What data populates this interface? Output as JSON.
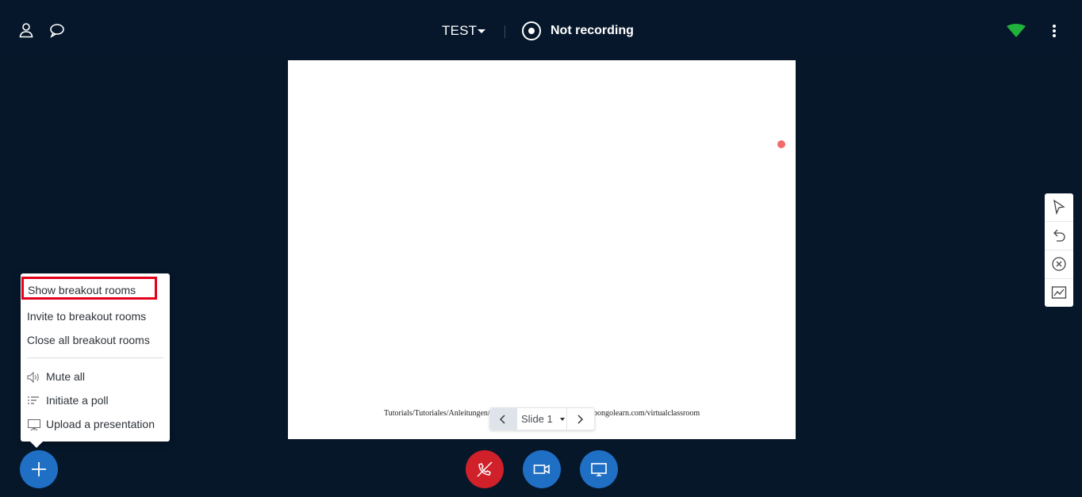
{
  "header": {
    "meeting_title": "TEST",
    "recording_status": "Not recording"
  },
  "presentation": {
    "footer_left": "Tutorials/Tutoriales/Anleitungen/",
    "footer_right": "bongolearn.com/virtualclassroom",
    "slide_selector": "Slide 1"
  },
  "actions_menu": {
    "items": [
      {
        "label": "Show breakout rooms"
      },
      {
        "label": "Invite to breakout rooms"
      },
      {
        "label": "Close all breakout rooms"
      },
      {
        "label": "Mute all",
        "icon": "speaker-icon"
      },
      {
        "label": "Initiate a poll",
        "icon": "poll-icon"
      },
      {
        "label": "Upload a presentation",
        "icon": "presentation-icon"
      }
    ]
  },
  "colors": {
    "background": "#06172a",
    "primary_blue": "#1f6fc5",
    "hangup_red": "#d0202a",
    "signal_green": "#1fb13a",
    "highlight_red": "#e3001b"
  },
  "icons": {
    "top_left": [
      "user-icon",
      "chat-icon"
    ],
    "top_right": [
      "connection-signal-icon",
      "more-options-icon"
    ],
    "toolbar": [
      "pointer-tool-icon",
      "undo-icon",
      "clear-annotations-icon",
      "multi-user-whiteboard-icon"
    ],
    "bottom": [
      "plus-icon",
      "hang-up-icon",
      "video-camera-icon",
      "screen-share-icon"
    ]
  }
}
